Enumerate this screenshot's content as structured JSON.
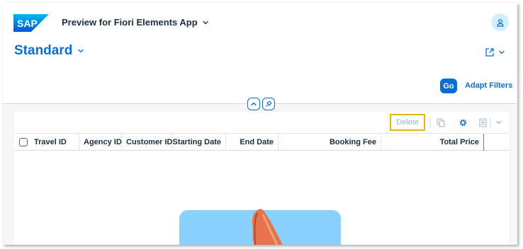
{
  "shell": {
    "logo_text": "SAP",
    "app_title": "Preview for Fiori Elements App",
    "avatar_icon": "user-icon"
  },
  "header": {
    "variant": "Standard",
    "share_icon": "share-icon"
  },
  "filterbar": {
    "go_label": "Go",
    "adapt_label": "Adapt Filters"
  },
  "toolbar": {
    "delete_label": "Delete",
    "icons": [
      "copy-icon",
      "settings-icon",
      "export-icon",
      "chevron-down-icon"
    ]
  },
  "table": {
    "columns": [
      {
        "label": "Travel ID",
        "align": "left"
      },
      {
        "label": "Agency ID",
        "align": "left"
      },
      {
        "label": "Customer ID",
        "align": "left"
      },
      {
        "label": "Starting Date",
        "align": "right"
      },
      {
        "label": "End Date",
        "align": "right"
      },
      {
        "label": "Booking Fee",
        "align": "right"
      },
      {
        "label": "Total Price",
        "align": "right"
      }
    ]
  },
  "colors": {
    "brand_blue": "#0a6ed1",
    "delete_highlight": "#e9b31b",
    "illustration_bg": "#89d1ff",
    "illustration_orange": "#e8734a"
  }
}
